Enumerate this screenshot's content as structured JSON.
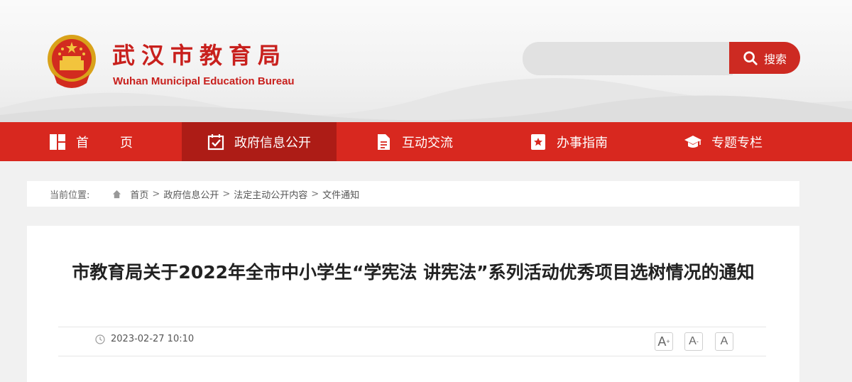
{
  "header": {
    "site_name": "武汉市教育局",
    "site_name_en": "Wuhan Municipal Education Bureau",
    "emblem_icon": "national-emblem-icon",
    "search": {
      "placeholder": "",
      "button_label": "搜索",
      "button_icon": "search-icon"
    }
  },
  "nav": {
    "items": [
      {
        "label": "首页",
        "icon": "home-grid-icon"
      },
      {
        "label": "政府信息公开",
        "icon": "checkbox-calendar-icon",
        "active": true
      },
      {
        "label": "互动交流",
        "icon": "document-icon"
      },
      {
        "label": "办事指南",
        "icon": "bookmark-star-icon"
      },
      {
        "label": "专题专栏",
        "icon": "graduation-cap-icon"
      }
    ]
  },
  "breadcrumb": {
    "lead": "当前位置:",
    "items": [
      "首页",
      "政府信息公开",
      "法定主动公开内容",
      "文件通知"
    ],
    "separator": ">"
  },
  "article": {
    "title": "市教育局关于2022年全市中小学生“学宪法 讲宪法”系列活动优秀项目选树情况的通知",
    "date": "2023-02-27 10:10",
    "font_size_controls": {
      "large": "A",
      "large_sup": "+",
      "medium": "A",
      "medium_sup": "-",
      "small": "A"
    }
  },
  "colors": {
    "brand_red": "#d8281f",
    "nav_active": "#ad1c16",
    "search_btn": "#cd2a22"
  }
}
